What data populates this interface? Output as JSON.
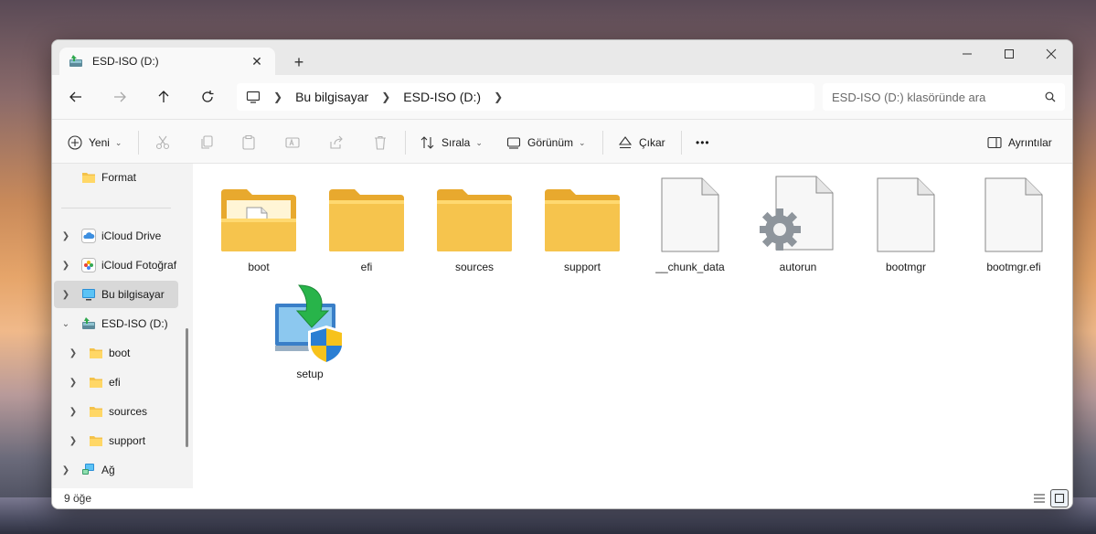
{
  "window": {
    "tab_title": "ESD-ISO (D:)",
    "new_tab": "+"
  },
  "address": {
    "crumbs": [
      "Bu bilgisayar",
      "ESD-ISO (D:)"
    ],
    "search_placeholder": "ESD-ISO (D:) klasöründe ara"
  },
  "toolbar": {
    "new_label": "Yeni",
    "sort_label": "Sırala",
    "view_label": "Görünüm",
    "eject_label": "Çıkar",
    "more_label": "•••",
    "details_label": "Ayrıntılar"
  },
  "sidebar": {
    "items": [
      {
        "label": "Format"
      },
      {
        "label": "iCloud Drive"
      },
      {
        "label": "iCloud Fotoğraf"
      },
      {
        "label": "Bu bilgisayar"
      },
      {
        "label": "ESD-ISO (D:)"
      },
      {
        "label": "boot"
      },
      {
        "label": "efi"
      },
      {
        "label": "sources"
      },
      {
        "label": "support"
      },
      {
        "label": "Ağ"
      }
    ]
  },
  "files": [
    {
      "name": "boot",
      "icon": "folder-with-document-icon"
    },
    {
      "name": "efi",
      "icon": "folder-icon"
    },
    {
      "name": "sources",
      "icon": "folder-icon"
    },
    {
      "name": "support",
      "icon": "folder-icon"
    },
    {
      "name": "__chunk_data",
      "icon": "blank-file-icon"
    },
    {
      "name": "autorun",
      "icon": "settings-file-icon"
    },
    {
      "name": "bootmgr",
      "icon": "blank-file-icon"
    },
    {
      "name": "bootmgr.efi",
      "icon": "blank-file-icon"
    },
    {
      "name": "setup",
      "icon": "setup-installer-icon"
    }
  ],
  "status": {
    "item_count": "9 öğe"
  },
  "colors": {
    "folder": "#f4c24a",
    "accent": "#0067c0"
  }
}
